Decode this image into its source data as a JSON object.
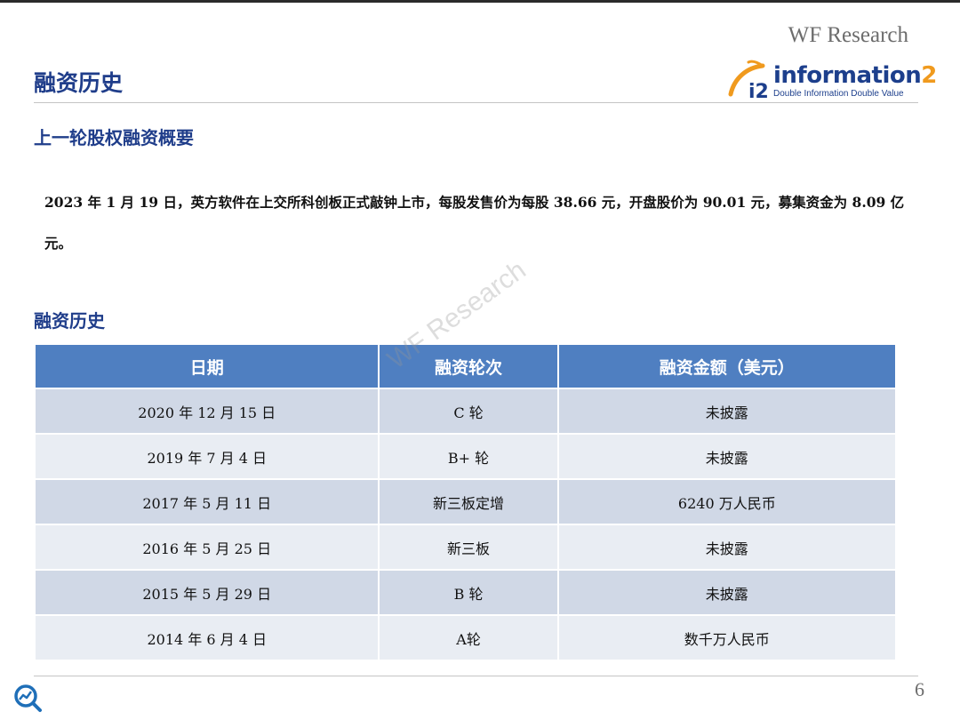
{
  "header": {
    "brand": "WF Research",
    "title": "融资历史"
  },
  "logo": {
    "badge": "i2",
    "word_main": "information",
    "word_accent": "2",
    "tagline": "Double Information Double Value"
  },
  "section_summary": {
    "heading": "上一轮股权融资概要",
    "text": "2023 年 1 月 19 日，英方软件在上交所科创板正式敲钟上市，每股发售价为每股 38.66 元，开盘股价为 90.01 元，募集资金为 8.09 亿元。"
  },
  "section_history": {
    "heading": "融资历史",
    "columns": [
      "日期",
      "融资轮次",
      "融资金额（美元）"
    ],
    "rows": [
      [
        "2020 年 12 月 15 日",
        "C 轮",
        "未披露"
      ],
      [
        "2019 年 7 月 4 日",
        "B+ 轮",
        "未披露"
      ],
      [
        "2017 年 5 月 11 日",
        "新三板定增",
        "6240 万人民币"
      ],
      [
        "2016 年 5 月 25 日",
        "新三板",
        "未披露"
      ],
      [
        "2015 年 5 月 29 日",
        "B 轮",
        "未披露"
      ],
      [
        "2014 年 6 月 4 日",
        "A轮",
        "数千万人民币"
      ]
    ]
  },
  "watermark": "WF Research",
  "footer": {
    "page_number": "6",
    "icon": "search-chart-icon"
  },
  "colors": {
    "title_blue": "#1f3d8a",
    "table_header": "#4f7fc1",
    "row_dark": "#d0d8e6",
    "row_light": "#e9edf3",
    "logo_orange": "#f09a1e"
  }
}
